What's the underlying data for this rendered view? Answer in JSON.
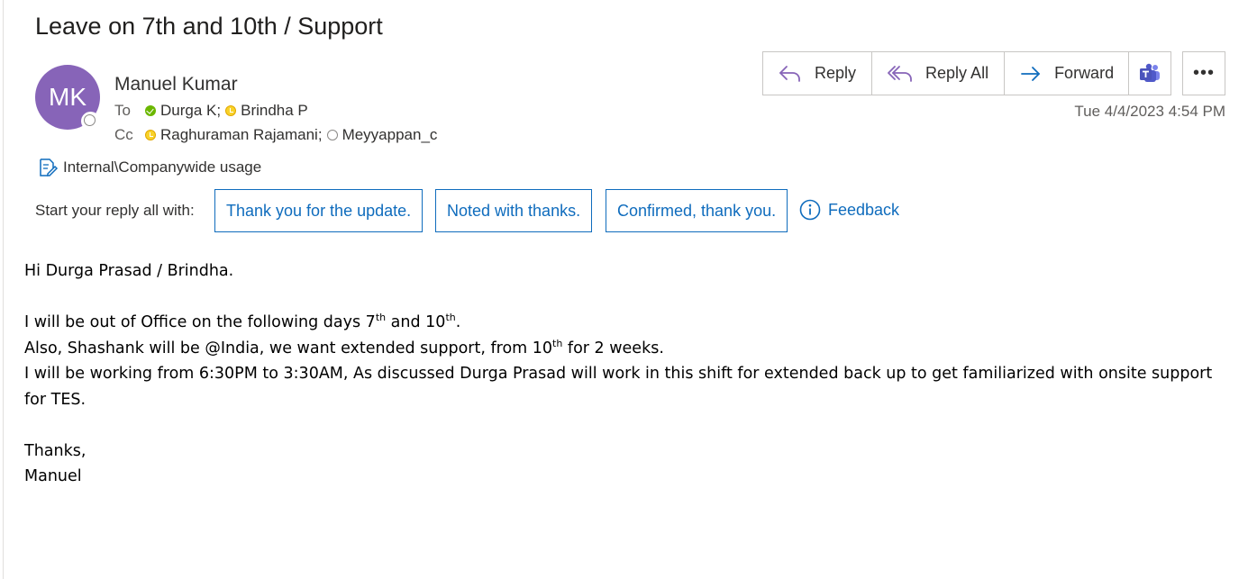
{
  "subject": "Leave on 7th and 10th / Support",
  "sender": {
    "initials": "MK",
    "name": "Manuel Kumar",
    "avatar_color": "#8764b8"
  },
  "to": {
    "label": "To",
    "recipients": [
      {
        "name": "Durga K",
        "presence": "available",
        "separator": ";"
      },
      {
        "name": "Brindha P",
        "presence": "away",
        "separator": ""
      }
    ]
  },
  "cc": {
    "label": "Cc",
    "recipients": [
      {
        "name": "Raghuraman Rajamani",
        "presence": "away",
        "separator": ";"
      },
      {
        "name": "Meyyappan_c",
        "presence": "offline",
        "separator": ""
      }
    ]
  },
  "sensitivity": {
    "icon": "sensitivity-label-icon",
    "label": "Internal\\Companywide usage"
  },
  "actions": {
    "reply": "Reply",
    "reply_all": "Reply All",
    "forward": "Forward",
    "teams_icon": "teams-icon",
    "more": "•••"
  },
  "timestamp": "Tue 4/4/2023 4:54 PM",
  "quick_replies": {
    "label": "Start your reply all with:",
    "suggestions": [
      "Thank you for the update.",
      "Noted with thanks.",
      "Confirmed, thank you."
    ],
    "feedback": "Feedback"
  },
  "body": {
    "greeting": "Hi Durga Prasad / Brindha.",
    "line1_a": "I will be out of Office on the following days 7",
    "line1_sup1": "th",
    "line1_b": " and 10",
    "line1_sup2": "th",
    "line1_c": ".",
    "line2_a": "Also, Shashank will be @India, we want extended support, from 10",
    "line2_sup": "th",
    "line2_b": " for 2 weeks.",
    "line3": "I will be working from 6:30PM to 3:30AM, As discussed Durga Prasad will work in this shift for extended back up to get familiarized with onsite support for TES.",
    "closing": "Thanks,",
    "signature": "Manuel"
  },
  "colors": {
    "accent": "#0f6cbd",
    "available": "#6bb700",
    "away": "#f8d22a",
    "reply_icon": "#8764b8",
    "forward_icon": "#0f6cbd"
  }
}
